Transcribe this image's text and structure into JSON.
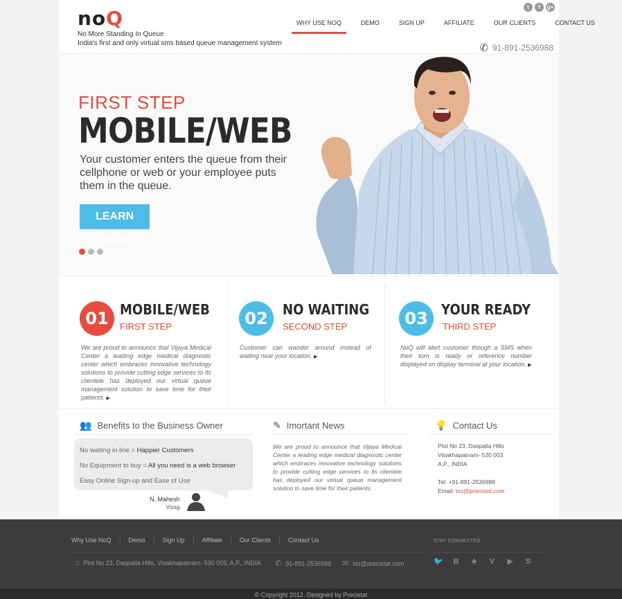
{
  "brand": {
    "logo_prefix": "no",
    "logo_q": "Q",
    "tagline_1": "No More Standing In Queue",
    "tagline_2": "India's first and only virtual sms based queue management system"
  },
  "nav": {
    "items": [
      "WHY USE NOQ",
      "DEMO",
      "SIGN UP",
      "AFFILIATE",
      "OUR CLIENTS",
      "CONTACT US"
    ],
    "active": 0
  },
  "social_top": {
    "icons": [
      "twitter-icon",
      "facebook-icon",
      "google-plus-icon"
    ]
  },
  "header_phone": "91-891-2536988",
  "hero": {
    "eyebrow": "FIRST STEP",
    "title": "MOBILE/WEB",
    "description": "Your customer enters the queue from their cellphone or web or your employee puts them in the queue.",
    "cta": "LEARN MORE",
    "slides": 3,
    "active_slide": 0
  },
  "steps": [
    {
      "num": "01",
      "title": "MOBILE/WEB",
      "subtitle": "FIRST STEP",
      "color": "#e84c3d",
      "desc": "We are proud to announce that Vijaya Medical Center a leading edge medical diagnostic center which embraces innovative technology solutions to provide cutting edge services to its clientele has deployed our virtual queue management solution to save time for their patients."
    },
    {
      "num": "02",
      "title": "NO WAITING",
      "subtitle": "SECOND STEP",
      "color": "#4dbde7",
      "desc": "Customer can wander around instead of waiting near your location."
    },
    {
      "num": "03",
      "title": "YOUR READY",
      "subtitle": "THIRD STEP",
      "color": "#4dbde7",
      "desc": "NoQ will alert customer though a SMS when their turn is ready or reference number displayed on display terminal at your location."
    }
  ],
  "benefits": {
    "title": "Benefits to the Business Owner",
    "lines": [
      {
        "a": "No waiting in line = ",
        "b": "Happier Customers"
      },
      {
        "a": "No Equipment to buy = ",
        "b": "All you need is a web browser"
      },
      {
        "a": "Easy Online Sign-up and Ease of Use",
        "b": ""
      }
    ],
    "author": "N. Mahesh",
    "location": "Vizag"
  },
  "news": {
    "title": "Imortant News",
    "text": "We are proud to announce that Vijaya Medical Center a leading edge medical diagnostic center which embraces innovative technology solutions to provide cutting edge services to its clientele has deployed our virtual queue management solution to save time for their patients."
  },
  "contact": {
    "title": "Contact Us",
    "address_1": "Plot No 23, Daspalla Hills",
    "address_2": "Visakhapatnam- 530 003",
    "address_3": "A.P., INDIA",
    "tel": "Tel: +91-891-2536988",
    "email_label": "Email: ",
    "email": "biz@precistat.com"
  },
  "footer": {
    "links": [
      "Why Use NoQ",
      "Demo",
      "Sign Up",
      "Affiliate",
      "Our Clients",
      "Contact Us"
    ],
    "address": "Plot No 23, Daspalla Hills, Visakhapatnam- 530 003, A.P., INDIA",
    "phone": "91-891-2536988",
    "email": "biz@precistat.com",
    "stay_connected": "STAY CONNECTED",
    "social": [
      "twitter-icon",
      "blogger-icon",
      "community-icon",
      "vimeo-icon",
      "youtube-icon",
      "skype-icon"
    ],
    "copyright": "© Copyright 2012. Designed by Precistat"
  }
}
